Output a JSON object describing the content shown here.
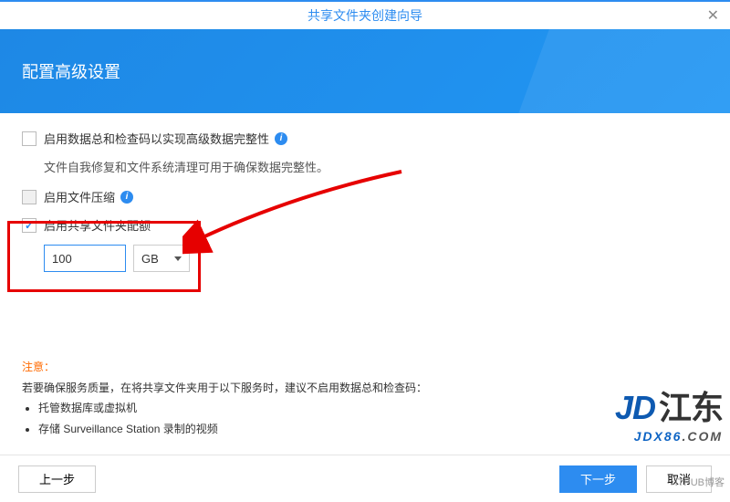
{
  "window": {
    "title": "共享文件夹创建向导"
  },
  "header": {
    "title": "配置高级设置"
  },
  "options": {
    "checksum": {
      "label": "启用数据总和检查码以实现高级数据完整性",
      "checked": false,
      "sub": "文件自我修复和文件系统清理可用于确保数据完整性。"
    },
    "compress": {
      "label": "启用文件压缩",
      "checked": false,
      "disabled": true
    },
    "quota": {
      "label": "启用共享文件夹配额",
      "checked": true,
      "value": "100",
      "unit": "GB"
    }
  },
  "notice": {
    "title": "注意：",
    "text": "若要确保服务质量，在将共享文件夹用于以下服务时，建议不启用数据总和检查码：",
    "bullets": [
      "托管数据库或虚拟机",
      "存储 Surveillance Station 录制的视频"
    ]
  },
  "footer": {
    "prev": "上一步",
    "next": "下一步",
    "cancel": "取消"
  },
  "watermark": {
    "brand": "JD",
    "cn": "江东",
    "small_a": "JDX86",
    "small_b": ".COM",
    "blog": "ITPUB博客"
  },
  "info_glyph": "i"
}
